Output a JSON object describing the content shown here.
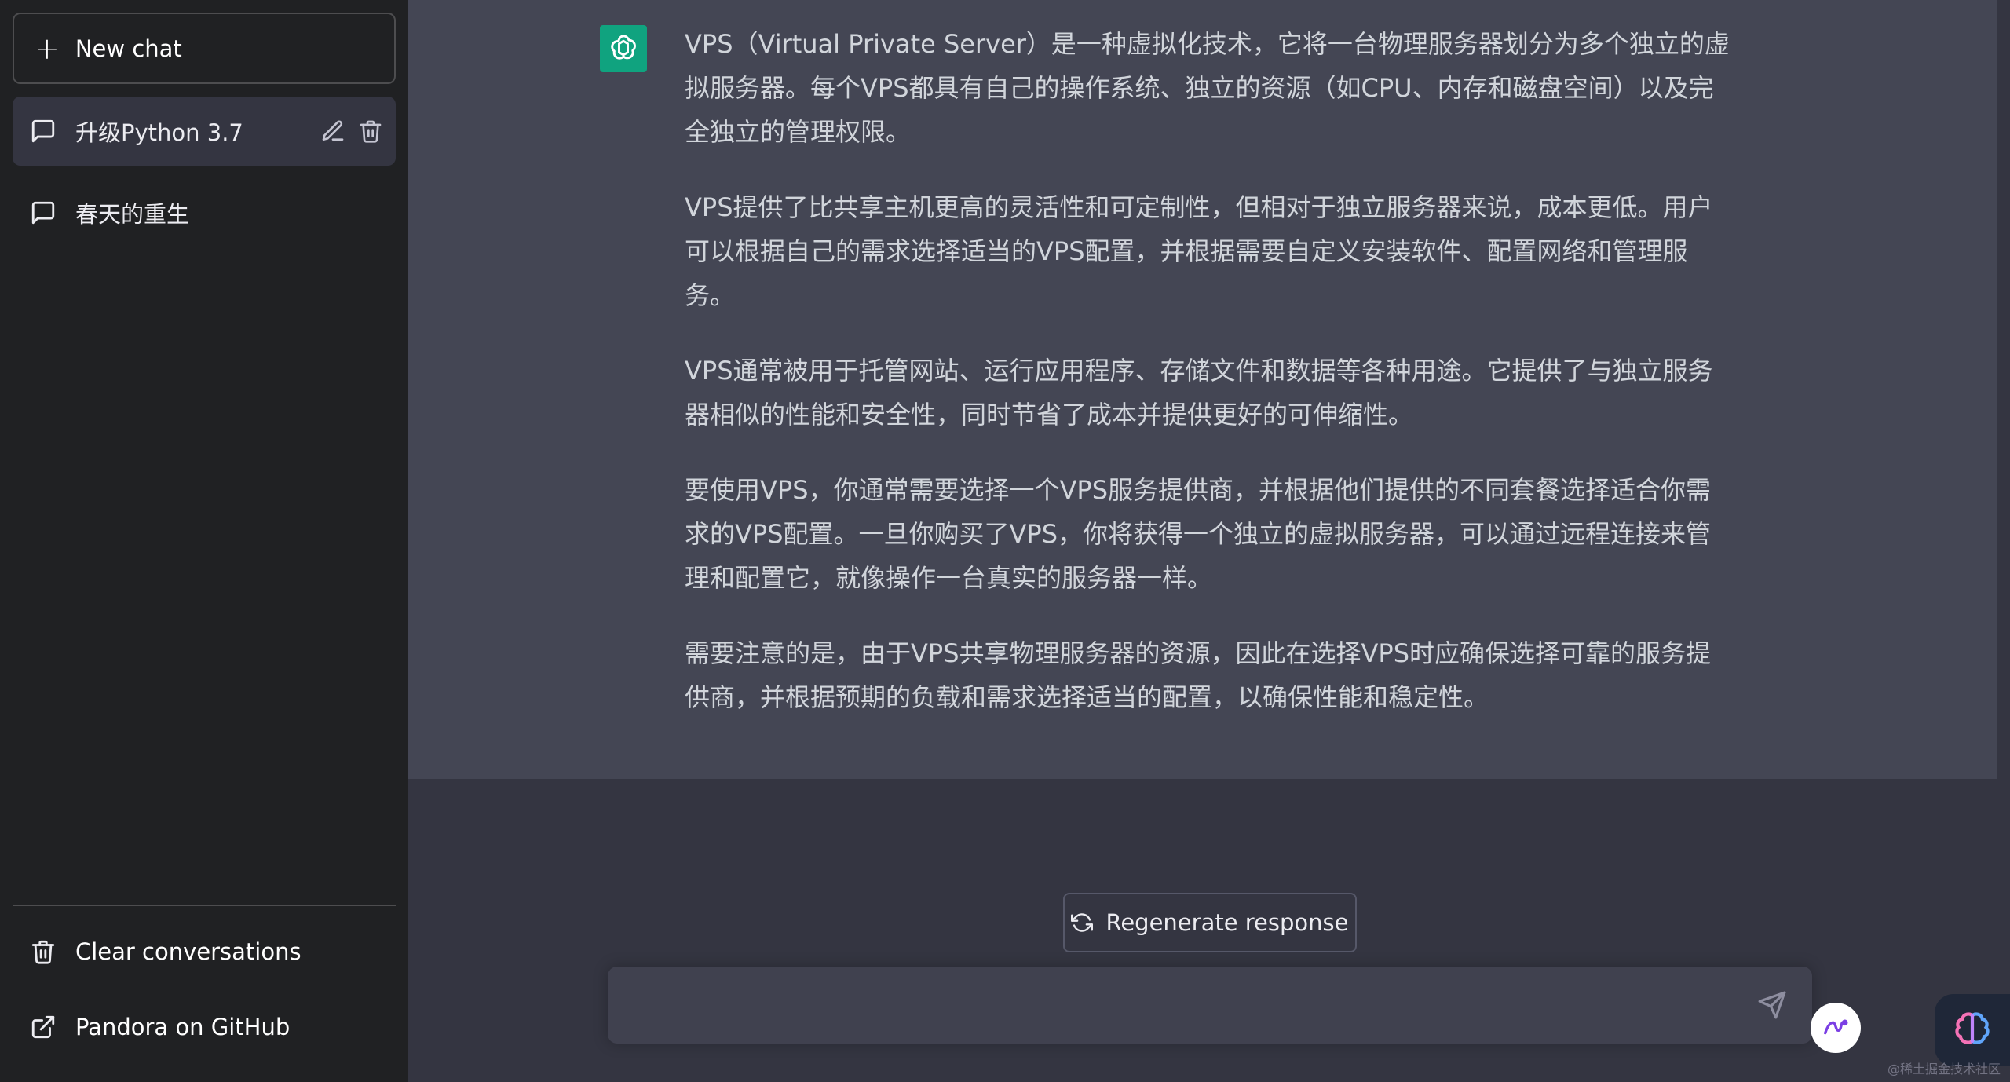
{
  "sidebar": {
    "new_chat_label": "New chat",
    "conversations": [
      {
        "label": "升级Python 3.7",
        "active": true
      },
      {
        "label": "春天的重生",
        "active": false
      }
    ],
    "bottom": {
      "clear_label": "Clear conversations",
      "github_label": "Pandora on GitHub"
    }
  },
  "message": {
    "paragraphs": [
      "VPS（Virtual Private Server）是一种虚拟化技术，它将一台物理服务器划分为多个独立的虚拟服务器。每个VPS都具有自己的操作系统、独立的资源（如CPU、内存和磁盘空间）以及完全独立的管理权限。",
      "VPS提供了比共享主机更高的灵活性和可定制性，但相对于独立服务器来说，成本更低。用户可以根据自己的需求选择适当的VPS配置，并根据需要自定义安装软件、配置网络和管理服务。",
      "VPS通常被用于托管网站、运行应用程序、存储文件和数据等各种用途。它提供了与独立服务器相似的性能和安全性，同时节省了成本并提供更好的可伸缩性。",
      "要使用VPS，你通常需要选择一个VPS服务提供商，并根据他们提供的不同套餐选择适合你需求的VPS配置。一旦你购买了VPS，你将获得一个独立的虚拟服务器，可以通过远程连接来管理和配置它，就像操作一台真实的服务器一样。",
      "需要注意的是，由于VPS共享物理服务器的资源，因此在选择VPS时应确保选择可靠的服务提供商，并根据预期的负载和需求选择适当的配置，以确保性能和稳定性。"
    ]
  },
  "composer": {
    "regenerate_label": "Regenerate response",
    "input_value": "",
    "placeholder": ""
  },
  "watermark": "@稀土掘金技术社区",
  "colors": {
    "sidebar_bg": "#202123",
    "main_bg": "#343541",
    "assistant_bg": "#444654",
    "brand_green": "#10a37f"
  },
  "icons": {
    "new_chat": "plus-icon",
    "conversation": "chat-bubble-icon",
    "edit": "pencil-icon",
    "delete": "trash-icon",
    "clear": "trash-icon",
    "github": "external-link-icon",
    "avatar": "openai-logo-icon",
    "regenerate": "refresh-icon",
    "send": "send-icon"
  }
}
